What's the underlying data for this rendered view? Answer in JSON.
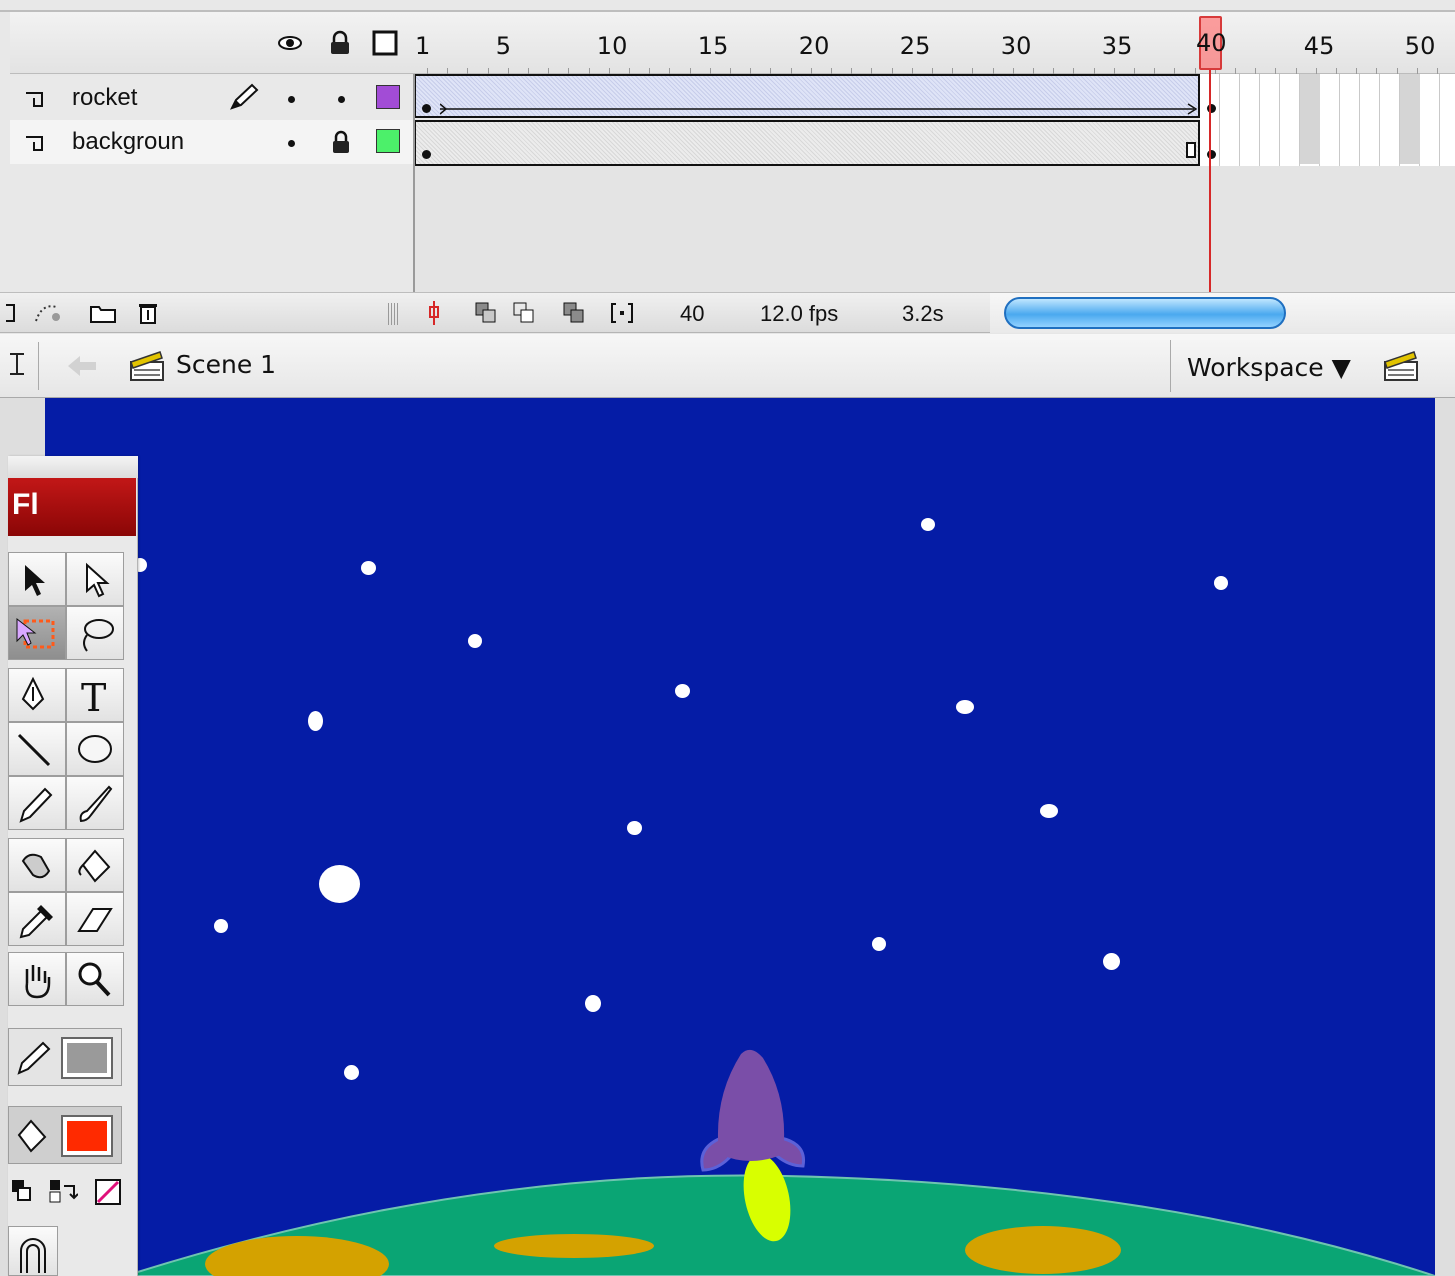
{
  "timeline": {
    "frame_numbers": [
      "1",
      "5",
      "10",
      "15",
      "20",
      "25",
      "30",
      "35",
      "40",
      "45",
      "50"
    ],
    "current_frame": "40",
    "layers": [
      {
        "name": "rocket",
        "color": "#a24cd6",
        "selected": true
      },
      {
        "name": "backgroun",
        "color": "#4cf06a",
        "selected": false
      }
    ],
    "footer": {
      "frame": "40",
      "fps": "12.0 fps",
      "elapsed": "3.2s"
    }
  },
  "editbar": {
    "scene": "Scene 1",
    "workspace": "Workspace ▼"
  },
  "toolbox": {
    "badge": "Fl",
    "fill_color": "#ff2a00",
    "stroke_color": "#9a9a9a"
  },
  "stage": {
    "background": "#051ca6",
    "ground_color": "#0aa574",
    "crater_color": "#d4a200",
    "rocket_color": "#7a4ea8",
    "flame_color": "#d8ff00"
  }
}
